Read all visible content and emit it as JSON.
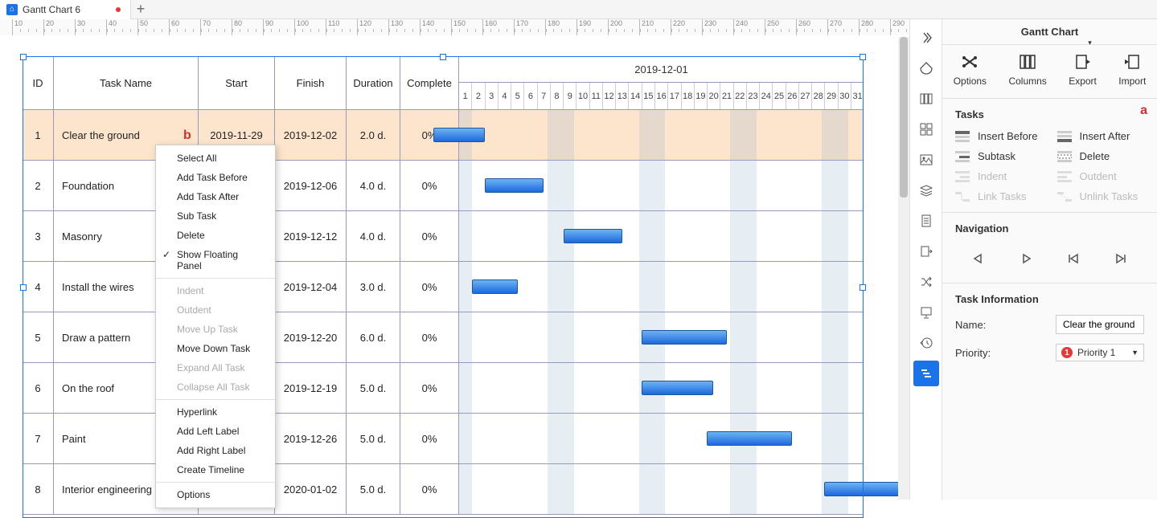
{
  "tab": {
    "title": "Gantt Chart 6"
  },
  "ruler_ticks": [
    "10",
    "20",
    "30",
    "40",
    "50",
    "60",
    "70",
    "80",
    "90",
    "100",
    "110",
    "120",
    "130",
    "140",
    "150",
    "160",
    "170",
    "180",
    "190",
    "200",
    "210",
    "220",
    "230",
    "240",
    "250",
    "260",
    "270",
    "280",
    "290"
  ],
  "annot": {
    "a": "a",
    "b": "b"
  },
  "headers": {
    "id": "ID",
    "name": "Task Name",
    "start": "Start",
    "finish": "Finish",
    "dur": "Duration",
    "comp": "Complete",
    "month": "2019-12-01"
  },
  "days": [
    "1",
    "2",
    "3",
    "4",
    "5",
    "6",
    "7",
    "8",
    "9",
    "10",
    "11",
    "12",
    "13",
    "14",
    "15",
    "16",
    "17",
    "18",
    "19",
    "20",
    "21",
    "22",
    "23",
    "24",
    "25",
    "26",
    "27",
    "28",
    "29",
    "30",
    "31"
  ],
  "rows": [
    {
      "id": "1",
      "name": "Clear the ground",
      "start": "2019-11-29",
      "finish": "2019-12-02",
      "dur": "2.0 d.",
      "comp": "0%",
      "selected": true
    },
    {
      "id": "2",
      "name": "Foundation",
      "start": "",
      "finish": "2019-12-06",
      "dur": "4.0 d.",
      "comp": "0%"
    },
    {
      "id": "3",
      "name": "Masonry",
      "start": "",
      "finish": "2019-12-12",
      "dur": "4.0 d.",
      "comp": "0%"
    },
    {
      "id": "4",
      "name": "Install the wires",
      "start": "",
      "finish": "2019-12-04",
      "dur": "3.0 d.",
      "comp": "0%"
    },
    {
      "id": "5",
      "name": "Draw a pattern",
      "start": "",
      "finish": "2019-12-20",
      "dur": "6.0 d.",
      "comp": "0%"
    },
    {
      "id": "6",
      "name": "On the roof",
      "start": "",
      "finish": "2019-12-19",
      "dur": "5.0 d.",
      "comp": "0%"
    },
    {
      "id": "7",
      "name": "Paint",
      "start": "",
      "finish": "2019-12-26",
      "dur": "5.0 d.",
      "comp": "0%"
    },
    {
      "id": "8",
      "name": "Interior engineering",
      "start": "",
      "finish": "2020-01-02",
      "dur": "5.0 d.",
      "comp": "0%"
    }
  ],
  "context_menu": [
    {
      "label": "Select All"
    },
    {
      "label": "Add Task Before"
    },
    {
      "label": "Add Task After"
    },
    {
      "label": "Sub Task"
    },
    {
      "label": "Delete"
    },
    {
      "label": "Show Floating Panel",
      "checked": true
    },
    {
      "sep": true
    },
    {
      "label": "Indent",
      "disabled": true
    },
    {
      "label": "Outdent",
      "disabled": true
    },
    {
      "label": "Move Up Task",
      "disabled": true
    },
    {
      "label": "Move Down Task"
    },
    {
      "label": "Expand All Task",
      "disabled": true
    },
    {
      "label": "Collapse All Task",
      "disabled": true
    },
    {
      "sep": true
    },
    {
      "label": "Hyperlink"
    },
    {
      "label": "Add Left Label"
    },
    {
      "label": "Add Right Label"
    },
    {
      "label": "Create Timeline"
    },
    {
      "sep": true
    },
    {
      "label": "Options"
    }
  ],
  "panel": {
    "title": "Gantt Chart",
    "tools": {
      "options": "Options",
      "columns": "Columns",
      "export": "Export",
      "import": "Import"
    },
    "tasks_heading": "Tasks",
    "buttons": {
      "insert_before": "Insert Before",
      "insert_after": "Insert After",
      "subtask": "Subtask",
      "delete": "Delete",
      "indent": "Indent",
      "outdent": "Outdent",
      "link": "Link Tasks",
      "unlink": "Unlink Tasks"
    },
    "nav_heading": "Navigation",
    "info_heading": "Task Information",
    "name_label": "Name:",
    "name_value": "Clear the ground",
    "prio_label": "Priority:",
    "prio_value": "Priority 1",
    "prio_num": "1"
  }
}
